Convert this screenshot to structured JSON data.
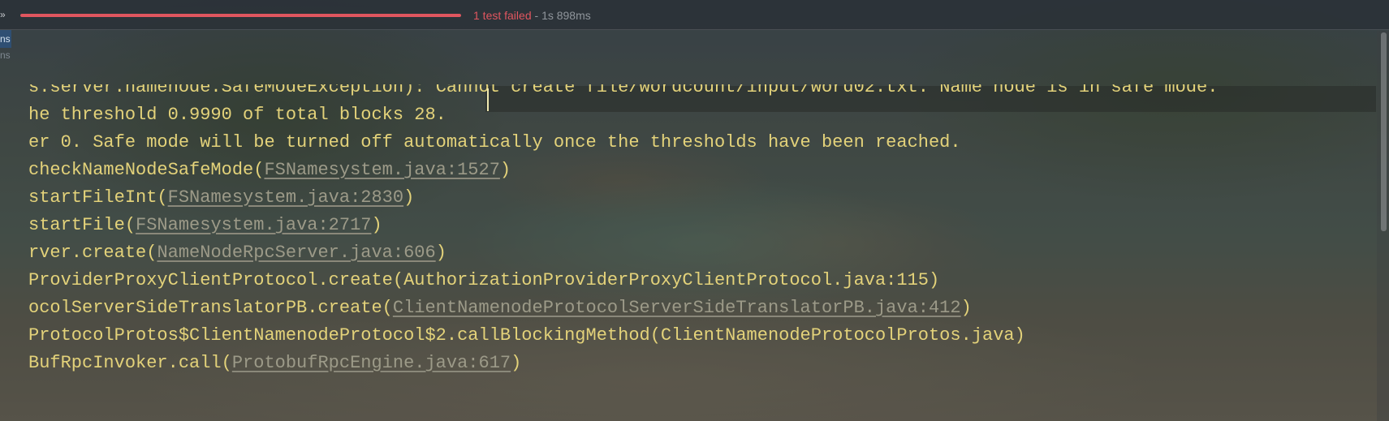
{
  "toolbar": {
    "expand_icon": "double-chevron-right-icon",
    "expand_glyph": "»",
    "progress": {
      "fraction": 1.0,
      "color": "#e0565f"
    },
    "status_failed": "1 test failed",
    "status_separator": " - ",
    "status_time": "1s 898ms"
  },
  "gutter": {
    "tabs": [
      {
        "label": "ns",
        "active": true
      },
      {
        "label": "ns",
        "active": false
      }
    ]
  },
  "console": {
    "lines": [
      {
        "parts": [
          {
            "text": "s.server.namenode.SafeModeException): "
          },
          {
            "text": "Cannot create file/wordcount/input/word02.txt. Name node is in safe mode."
          }
        ]
      },
      {
        "parts": [
          {
            "text": "he threshold 0.9990 of total blocks 28."
          }
        ]
      },
      {
        "parts": [
          {
            "text": "er 0. Safe mode will be turned off automatically once the thresholds have been reached."
          }
        ]
      },
      {
        "parts": [
          {
            "text": "checkNameNodeSafeMode("
          },
          {
            "text": "FSNamesystem.java:1527",
            "link": true
          },
          {
            "text": ")"
          }
        ]
      },
      {
        "parts": [
          {
            "text": "startFileInt("
          },
          {
            "text": "FSNamesystem.java:2830",
            "link": true
          },
          {
            "text": ")"
          }
        ]
      },
      {
        "parts": [
          {
            "text": "startFile("
          },
          {
            "text": "FSNamesystem.java:2717",
            "link": true
          },
          {
            "text": ")"
          }
        ]
      },
      {
        "parts": [
          {
            "text": "rver.create("
          },
          {
            "text": "NameNodeRpcServer.java:606",
            "link": true
          },
          {
            "text": ")"
          }
        ]
      },
      {
        "parts": [
          {
            "text": "ProviderProxyClientProtocol.create(AuthorizationProviderProxyClientProtocol.java:115)"
          }
        ]
      },
      {
        "parts": [
          {
            "text": "ocolServerSideTranslatorPB.create("
          },
          {
            "text": "ClientNamenodeProtocolServerSideTranslatorPB.java:412",
            "link": true
          },
          {
            "text": ")"
          }
        ]
      },
      {
        "parts": [
          {
            "text": "ProtocolProtos$ClientNamenodeProtocol$2.callBlockingMethod(ClientNamenodeProtocolProtos.java)"
          }
        ]
      },
      {
        "parts": [
          {
            "text": "BufRpcInvoker.call("
          },
          {
            "text": "ProtobufRpcEngine.java:617",
            "link": true
          },
          {
            "text": ")"
          }
        ]
      }
    ]
  },
  "colors": {
    "console_text": "#e3d27a",
    "link_text": "#9c9a88",
    "failed": "#e0565f"
  }
}
